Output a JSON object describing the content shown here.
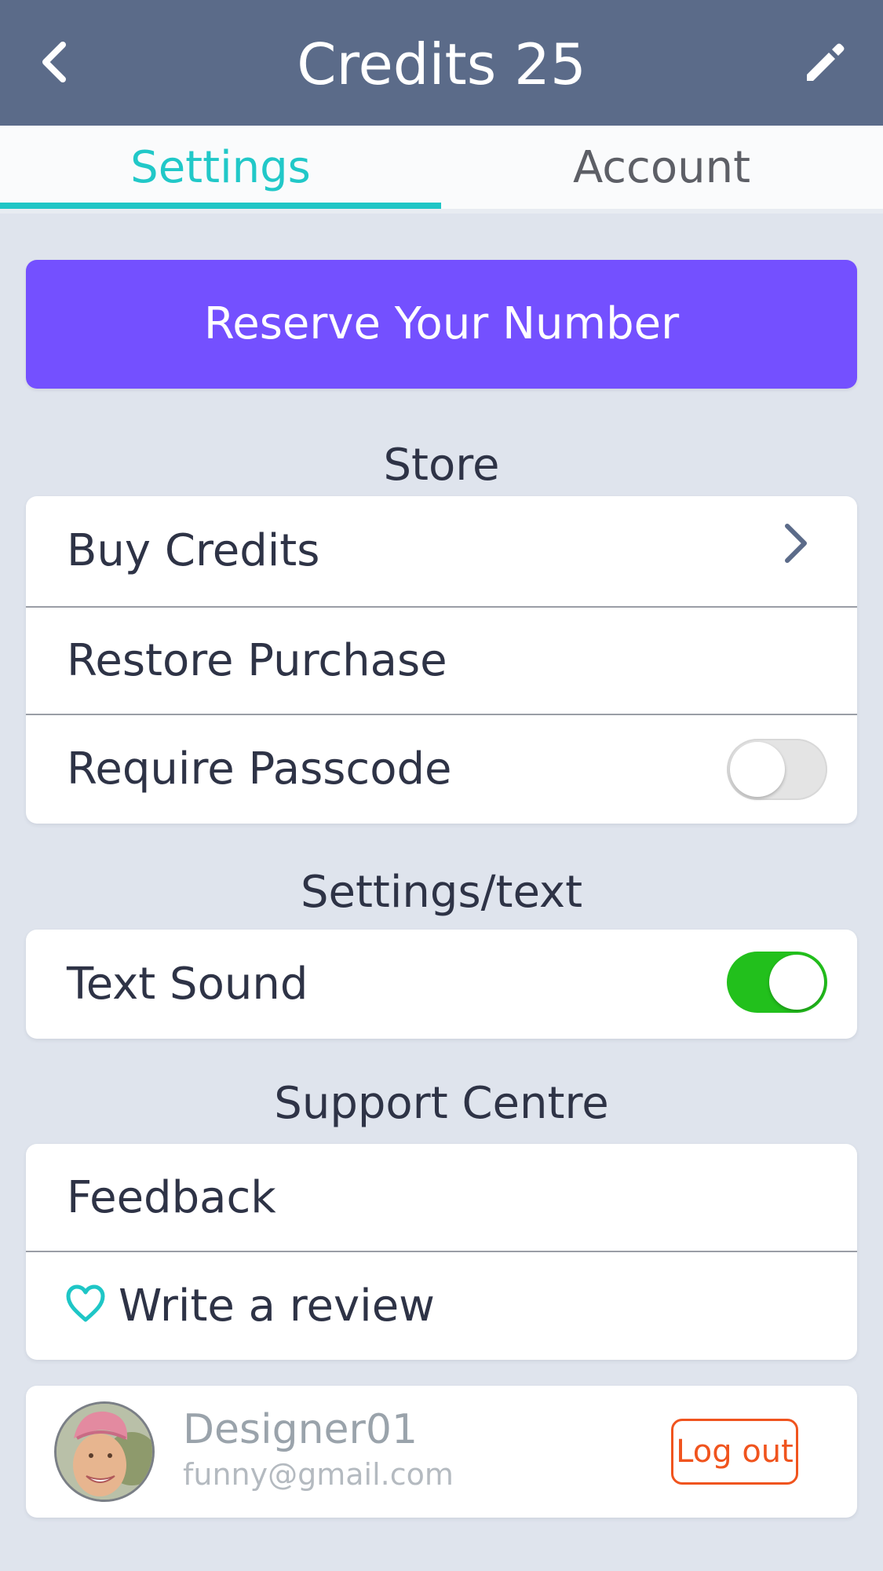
{
  "header": {
    "title": "Credits 25",
    "back_icon": "chevron-left-icon",
    "edit_icon": "pencil-icon",
    "background": "#5b6b89"
  },
  "tabs": [
    {
      "label": "Settings",
      "active": true
    },
    {
      "label": "Account",
      "active": false
    }
  ],
  "accent_color": "#1ec6c6",
  "reserve_button": {
    "label": "Reserve Your Number",
    "color": "#7450ff"
  },
  "store": {
    "title": "Store",
    "items": [
      {
        "label": "Buy Credits",
        "icon": "chevron-right-icon"
      },
      {
        "label": "Restore Purchase"
      },
      {
        "label": "Require Passcode",
        "toggle": false
      }
    ]
  },
  "settings_text": {
    "title": "Settings/text",
    "items": [
      {
        "label": "Text Sound",
        "toggle": true,
        "toggle_color": "#22c01c"
      }
    ]
  },
  "support": {
    "title": "Support Centre",
    "items": [
      {
        "label": "Feedback"
      },
      {
        "label": "Write a review",
        "icon": "heart-icon"
      }
    ]
  },
  "profile": {
    "username": "Designer01",
    "email": "funny@gmail.com",
    "avatar_icon": "avatar",
    "logout_label": "Log out",
    "logout_color": "#f0541e"
  }
}
